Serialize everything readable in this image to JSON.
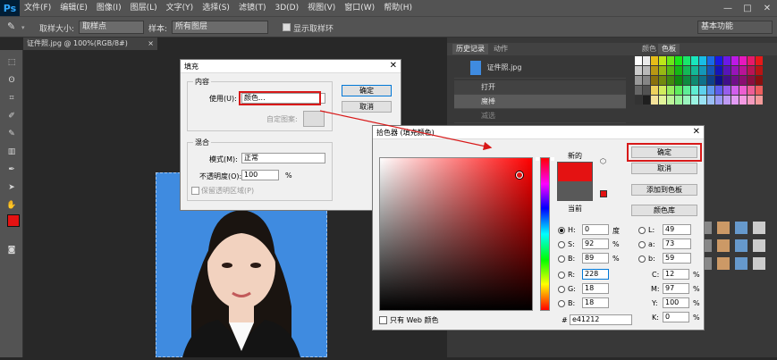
{
  "app": {
    "logo": "Ps"
  },
  "menu": [
    "文件(F)",
    "编辑(E)",
    "图像(I)",
    "图层(L)",
    "文字(Y)",
    "选择(S)",
    "滤镜(T)",
    "3D(D)",
    "视图(V)",
    "窗口(W)",
    "帮助(H)"
  ],
  "window_controls": [
    "—",
    "□",
    "✕"
  ],
  "options": {
    "sample_size_label": "取样大小:",
    "sample_size_value": "取样点",
    "sample_label": "样本:",
    "sample_value": "所有图层",
    "show_ring_label": "显示取样环",
    "workspace": "基本功能"
  },
  "document": {
    "tab_title": "证件照.jpg @ 100%(RGB/8#)",
    "tab_close": "×"
  },
  "history_panel": {
    "tabs": [
      "历史记录",
      "动作"
    ],
    "snapshot_name": "证件照.jpg",
    "items": [
      "打开",
      "魔棒",
      "减选"
    ]
  },
  "swatches_panel": {
    "tabs": [
      "颜色",
      "色板"
    ]
  },
  "fill_dialog": {
    "title": "填充",
    "close": "✕",
    "content_group": "内容",
    "use_label": "使用(U):",
    "use_value": "颜色...",
    "custom_pattern_label": "自定图案:",
    "blend_group": "混合",
    "mode_label": "模式(M):",
    "mode_value": "正常",
    "opacity_label": "不透明度(O):",
    "opacity_value": "100",
    "opacity_unit": "%",
    "preserve_label": "保留透明区域(P)",
    "ok": "确定",
    "cancel": "取消"
  },
  "color_picker": {
    "title": "拾色器 (填充颜色)",
    "close": "✕",
    "new_label": "新的",
    "current_label": "当前",
    "ok": "确定",
    "cancel": "取消",
    "add_swatch": "添加到色板",
    "color_libraries": "颜色库",
    "web_only_label": "只有 Web 颜色",
    "new_color": "#e41212",
    "current_color": "#595959",
    "hue_level": 0.0,
    "sat_level": 0.92,
    "bri_level": 0.89,
    "fields": {
      "H": {
        "label": "H:",
        "value": "0",
        "unit": "度"
      },
      "S": {
        "label": "S:",
        "value": "92",
        "unit": "%"
      },
      "B": {
        "label": "B:",
        "value": "89",
        "unit": "%"
      },
      "R": {
        "label": "R:",
        "value": "228"
      },
      "G": {
        "label": "G:",
        "value": "18"
      },
      "Bl": {
        "label": "B:",
        "value": "18"
      },
      "L": {
        "label": "L:",
        "value": "49"
      },
      "a": {
        "label": "a:",
        "value": "73"
      },
      "b": {
        "label": "b:",
        "value": "59"
      },
      "C": {
        "label": "C:",
        "value": "12",
        "unit": "%"
      },
      "M": {
        "label": "M:",
        "value": "97",
        "unit": "%"
      },
      "Y": {
        "label": "Y:",
        "value": "100",
        "unit": "%"
      },
      "K": {
        "label": "K:",
        "value": "0",
        "unit": "%"
      },
      "hex_label": "#",
      "hex": "e41212"
    }
  },
  "colors": {
    "foreground": "#e41212",
    "background": "#ffffff",
    "selection_bg": "#3f8be0",
    "annotation": "#d81919"
  }
}
